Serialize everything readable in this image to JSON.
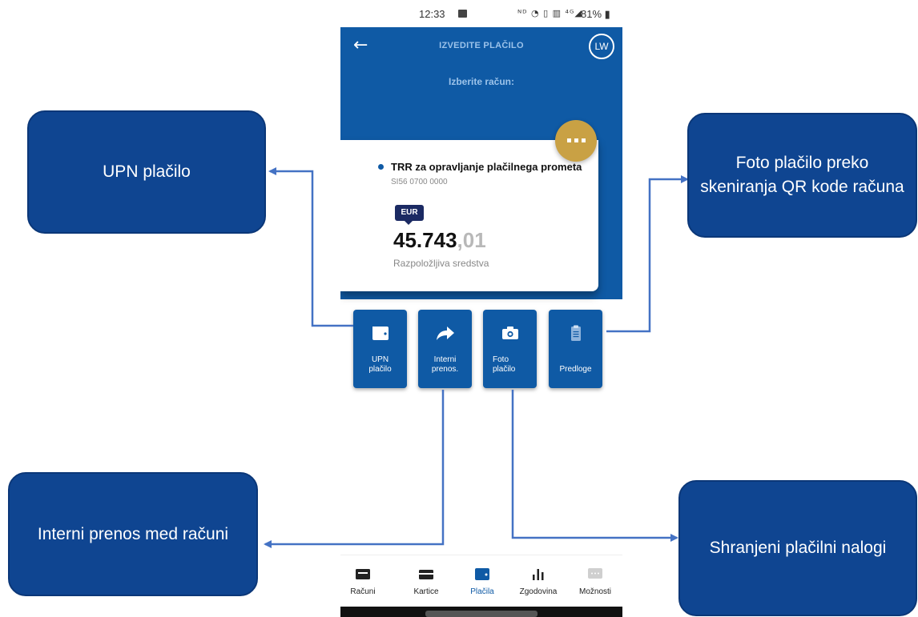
{
  "status_bar": {
    "time": "12:33",
    "icons": "ᴺᴰ ◔ ▯ ▥ ⁴ᴳ◢",
    "battery": "81%"
  },
  "header": {
    "title": "IZVEDITE PLAČILO",
    "avatar": "LW",
    "subtitle": "Izberite račun:"
  },
  "account": {
    "name": "TRR za opravljanje plačilnega prometa",
    "iban": "SI56 0700 0000",
    "currency": "EUR",
    "balance_main": "45.743",
    "balance_cents": ",01",
    "balance_label": "Razpoložljiva sredstva"
  },
  "actions": [
    {
      "label": "UPN\nplačilo",
      "icon": "wallet-icon"
    },
    {
      "label": "Interni\nprenos.",
      "icon": "share-arrow-icon"
    },
    {
      "label": "Foto\nplačilo",
      "icon": "camera-icon"
    },
    {
      "label": "Predloge",
      "icon": "clipboard-icon"
    }
  ],
  "nav": [
    {
      "label": "Računi",
      "icon": "accounts-icon"
    },
    {
      "label": "Kartice",
      "icon": "card-icon"
    },
    {
      "label": "Plačila",
      "icon": "wallet-icon",
      "active": true
    },
    {
      "label": "Zgodovina",
      "icon": "bar-chart-icon"
    },
    {
      "label": "Možnosti",
      "icon": "chat-dots-icon"
    }
  ],
  "callouts": {
    "upn": "UPN plačilo",
    "foto": "Foto plačilo preko skeniranja QR kode računa",
    "interni": "Interni prenos med računi",
    "shranjeni": "Shranjeni plačilni nalogi"
  },
  "colors": {
    "primary": "#0f5aa5",
    "callout": "#0f4591",
    "accent_gold": "#c9a144",
    "connector": "#4472c4"
  }
}
